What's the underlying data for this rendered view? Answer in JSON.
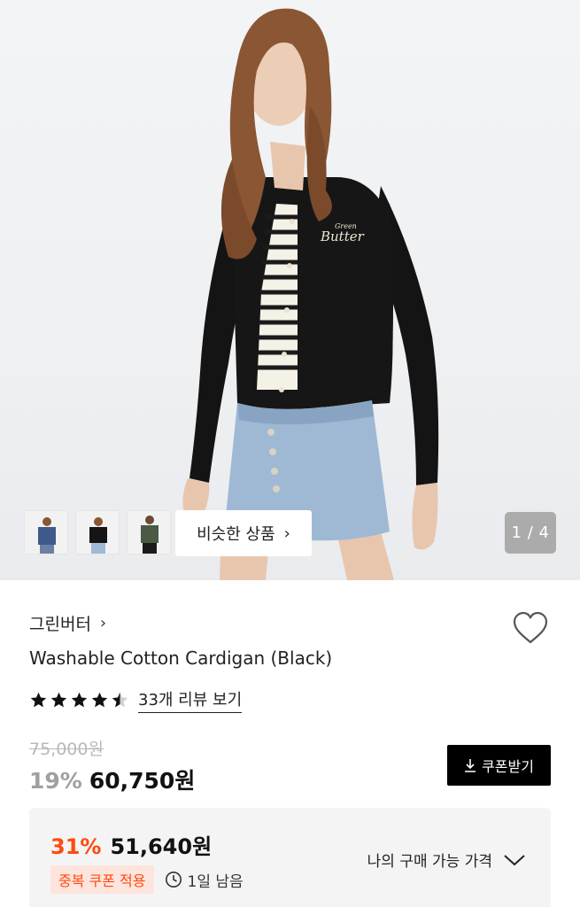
{
  "gallery": {
    "pager": "1 / 4",
    "similar_label": "비슷한 상품",
    "similar_chevron": "›",
    "thumbs": [
      {
        "name": "thumb-blue-cardigan"
      },
      {
        "name": "thumb-black-cardigan"
      },
      {
        "name": "thumb-green-cardigan"
      }
    ]
  },
  "product": {
    "brand": "그린버터",
    "brand_arrow": "›",
    "title": "Washable Cotton Cardigan (Black)",
    "rating": 4.5,
    "review_link": "33개 리뷰 보기"
  },
  "pricing": {
    "original": "75,000원",
    "discount": "19%",
    "price": "60,750원",
    "coupon_button": "쿠폰받기"
  },
  "member_price": {
    "discount": "31%",
    "amount": "51,640원",
    "tag": "중복 쿠폰 적용",
    "time_left": "1일 남음",
    "label": "나의 구매 가능 가격"
  },
  "colors": {
    "accent": "#ff4a0d",
    "tag_bg": "#fde4dc",
    "coupon_bg": "#000000"
  }
}
